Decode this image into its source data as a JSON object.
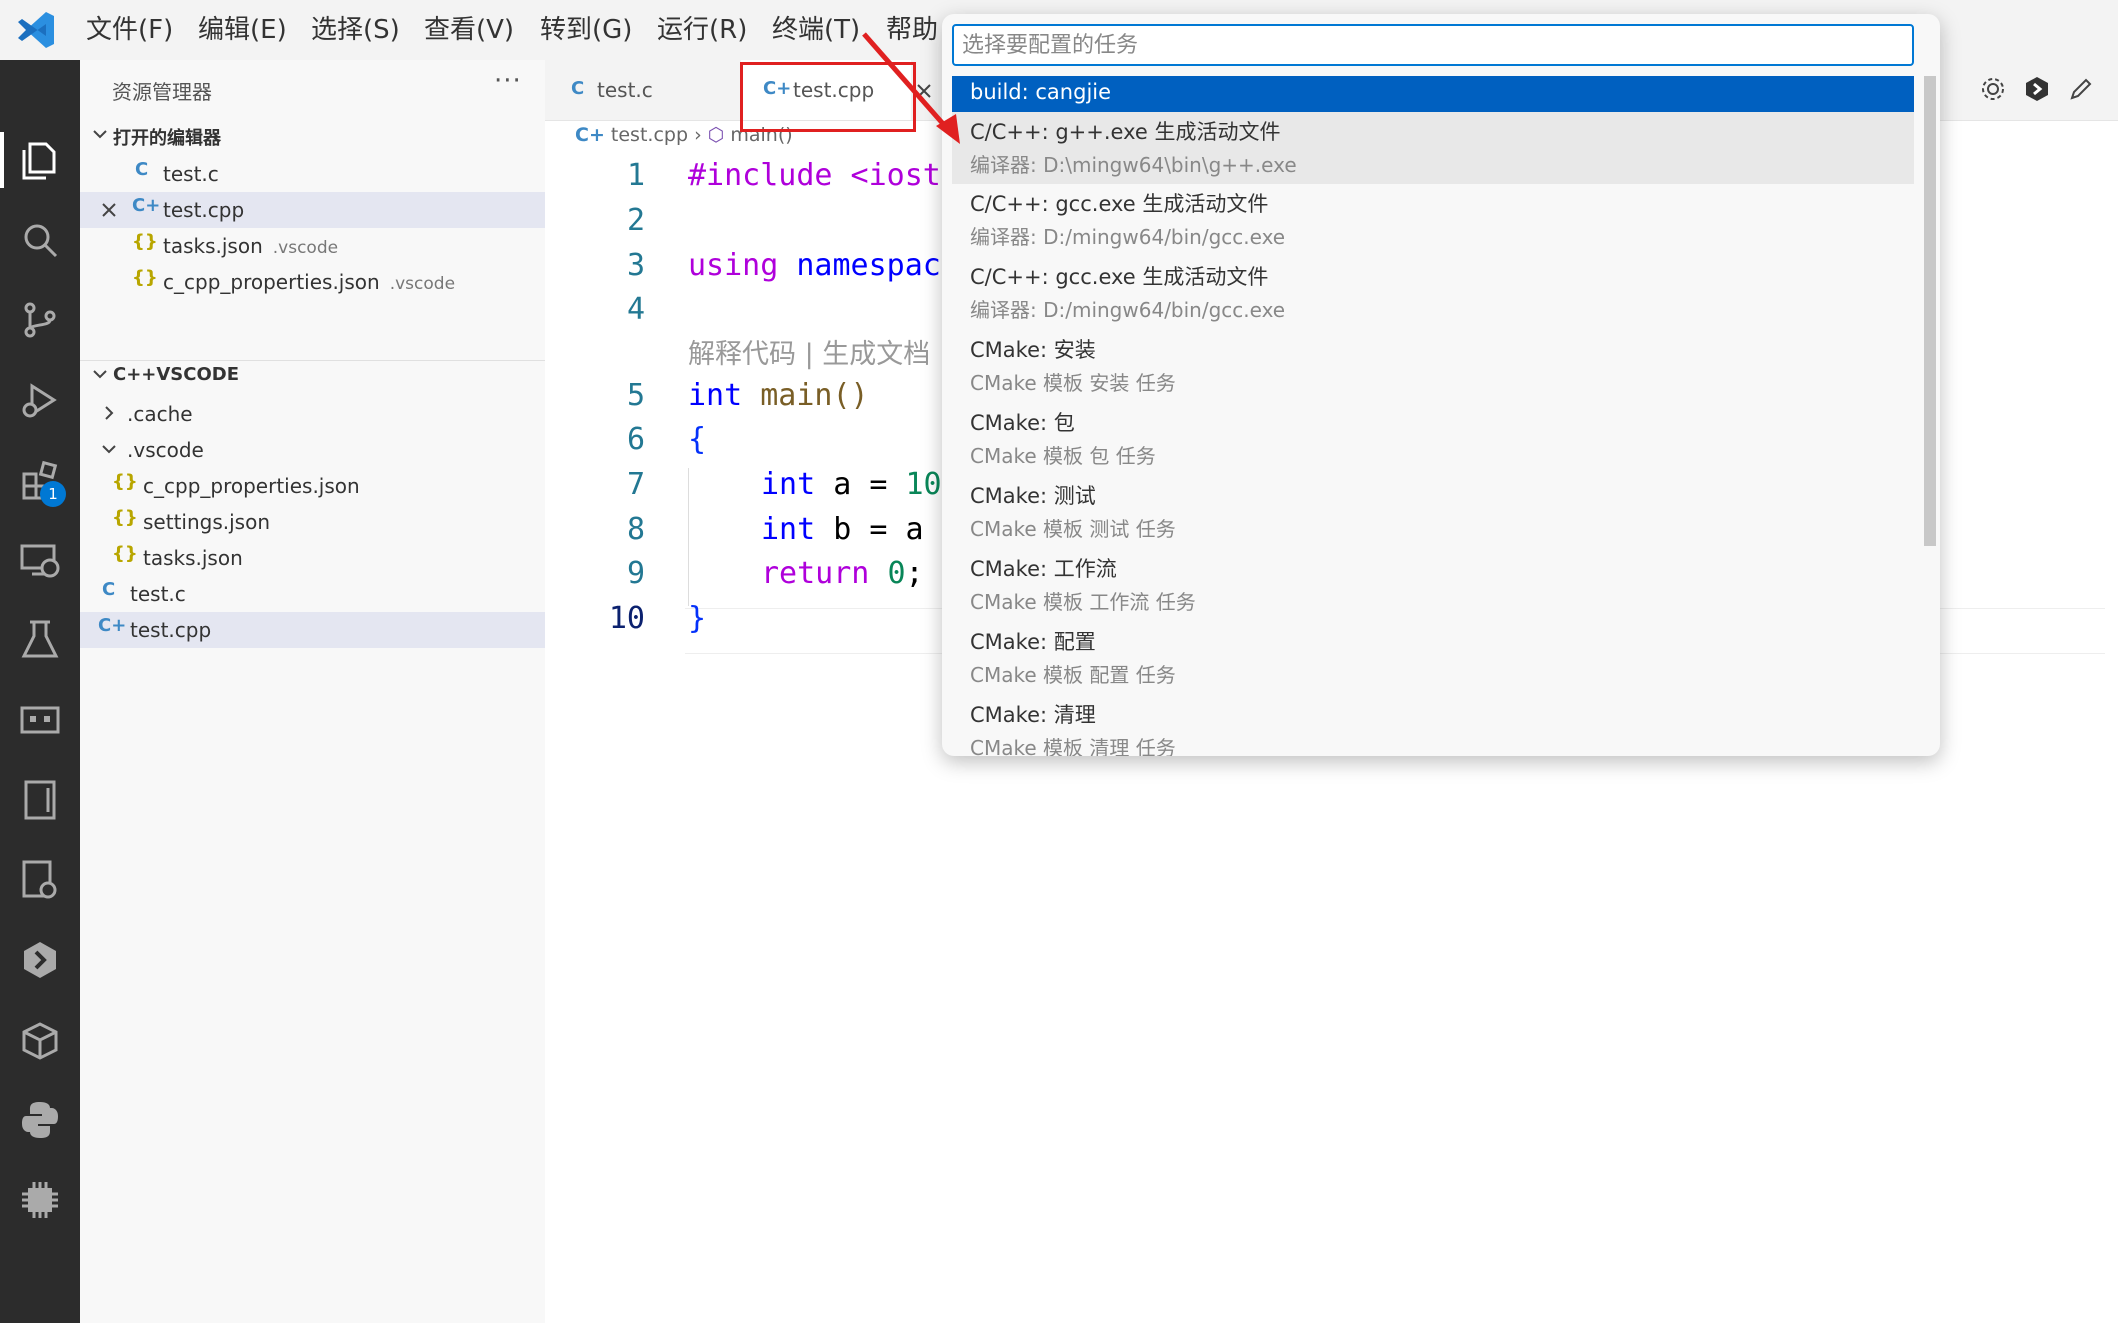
{
  "menubar": {
    "items": [
      "文件(F)",
      "编辑(E)",
      "选择(S)",
      "查看(V)",
      "转到(G)",
      "运行(R)",
      "终端(T)",
      "帮助"
    ]
  },
  "activity": {
    "icons": [
      "files-icon",
      "search-icon",
      "source-control-icon",
      "run-debug-icon",
      "extensions-icon",
      "remote-explorer-icon",
      "testing-icon",
      "panel-icon",
      "notebook-icon",
      "settings-sync-icon",
      "cangjie-icon",
      "container-icon",
      "python-icon",
      "chip-icon"
    ],
    "extensions_badge": "1"
  },
  "sidebar": {
    "title": "资源管理器",
    "more": "···",
    "open_editors": {
      "header": "打开的编辑器",
      "items": [
        {
          "icon": "C",
          "name": "test.c",
          "hint": ""
        },
        {
          "icon": "C+",
          "name": "test.cpp",
          "hint": ""
        },
        {
          "icon": "{}",
          "name": "tasks.json",
          "hint": ".vscode"
        },
        {
          "icon": "{}",
          "name": "c_cpp_properties.json",
          "hint": ".vscode"
        }
      ]
    },
    "workspace": {
      "header": "C++VSCODE",
      "items": [
        {
          "name": ".cache"
        },
        {
          "name": ".vscode"
        },
        {
          "icon": "{}",
          "name": "c_cpp_properties.json"
        },
        {
          "icon": "{}",
          "name": "settings.json"
        },
        {
          "icon": "{}",
          "name": "tasks.json"
        },
        {
          "icon": "C",
          "name": "test.c"
        },
        {
          "icon": "C+",
          "name": "test.cpp"
        }
      ]
    }
  },
  "tabs": [
    {
      "icon": "C",
      "name": "test.c"
    },
    {
      "icon": "C+",
      "name": "test.cpp"
    }
  ],
  "breadcrumb": {
    "file": "test.cpp",
    "symbol": "main()"
  },
  "editor": {
    "line_numbers": [
      "1",
      "2",
      "3",
      "4",
      "5",
      "6",
      "7",
      "8",
      "9",
      "10"
    ],
    "codelens": "解释代码 | 生成文档",
    "lines": {
      "l1": "#include <iost",
      "l3a": "using",
      "l3b": " namespac",
      "l5a": "int",
      "l5b": " main()",
      "l6": "{",
      "l7a": "int",
      "l7b": " a = ",
      "l7c": "10",
      "l8a": "int",
      "l8b": " b = a",
      "l9a": "return",
      "l9b": " ",
      "l9c": "0",
      "l9d": ";",
      "l10": "}"
    }
  },
  "quickpick": {
    "placeholder": "选择要配置的任务",
    "items": [
      {
        "label": "build: cangjie",
        "detail": ""
      },
      {
        "label": "C/C++: g++.exe 生成活动文件",
        "detail": "编译器: D:\\mingw64\\bin\\g++.exe"
      },
      {
        "label": "C/C++: gcc.exe 生成活动文件",
        "detail": "编译器: D:/mingw64/bin/gcc.exe"
      },
      {
        "label": "C/C++: gcc.exe 生成活动文件",
        "detail": "编译器: D:/mingw64/bin/gcc.exe"
      },
      {
        "label": "CMake: 安装",
        "detail": "CMake 模板 安装 任务"
      },
      {
        "label": "CMake: 包",
        "detail": "CMake 模板 包 任务"
      },
      {
        "label": "CMake: 测试",
        "detail": "CMake 模板 测试 任务"
      },
      {
        "label": "CMake: 工作流",
        "detail": "CMake 模板 工作流 任务"
      },
      {
        "label": "CMake: 配置",
        "detail": "CMake 模板 配置 任务"
      },
      {
        "label": "CMake: 清理",
        "detail": "CMake 模板 清理 任务"
      }
    ]
  },
  "colors": {
    "accent": "#0078d4",
    "selected_item": "#0060c0",
    "annotation_red": "#e02020"
  }
}
